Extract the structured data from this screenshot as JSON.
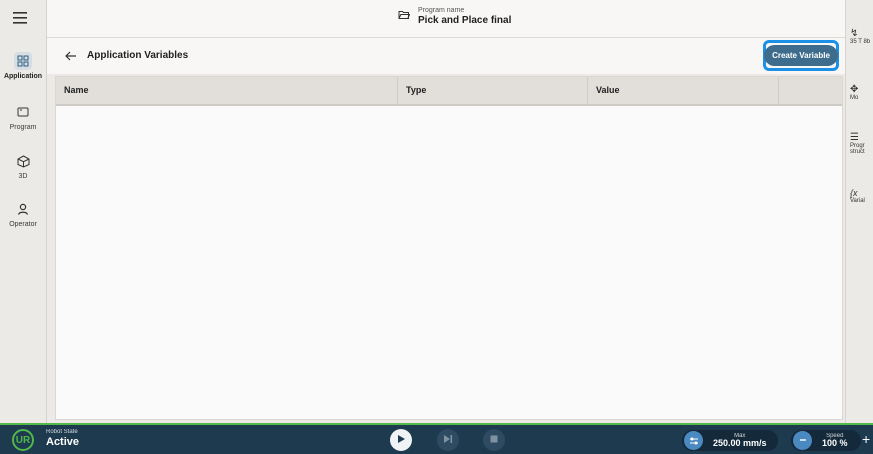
{
  "program": {
    "label": "Program name",
    "name": "Pick and Place final"
  },
  "nav": {
    "items": [
      {
        "label": "Application",
        "icon": "grid-icon",
        "active": true
      },
      {
        "label": "Program",
        "icon": "window-icon"
      },
      {
        "label": "3D",
        "icon": "cube-icon"
      },
      {
        "label": "Operator",
        "icon": "user-icon"
      }
    ]
  },
  "page": {
    "title": "Application Variables",
    "create_label": "Create Variable"
  },
  "table": {
    "headers": [
      "Name",
      "Type",
      "Value",
      ""
    ]
  },
  "right_panel": {
    "items": [
      {
        "label": "35 T 8b"
      },
      {
        "label": "Mo"
      },
      {
        "label": "Progr struct"
      },
      {
        "label": "Varial"
      }
    ]
  },
  "status": {
    "state_label": "Robot State",
    "state_value": "Active",
    "speed_label": "Max",
    "speed_value": "250.00 mm/s",
    "slider_label": "Speed",
    "slider_value": "100 %"
  },
  "colors": {
    "accent": "#3d6c8c",
    "highlight": "#1a91e6",
    "bottombar": "#1d3a4f",
    "status_green": "#53b948"
  }
}
